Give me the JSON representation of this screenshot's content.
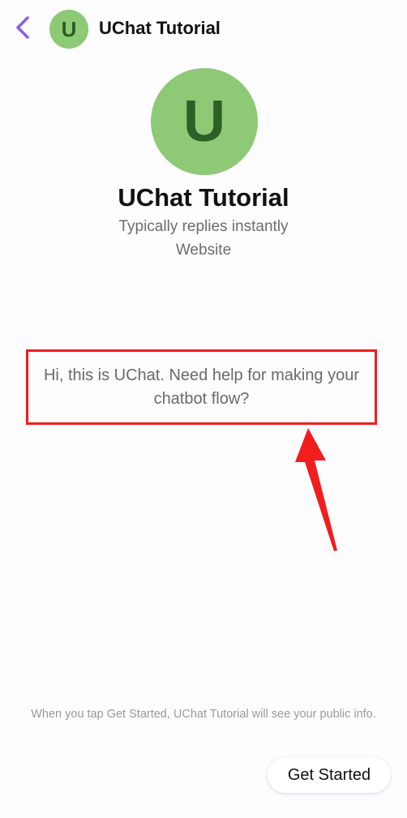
{
  "header": {
    "back_icon": "chevron-left-icon",
    "avatar_letter": "U",
    "title": "UChat Tutorial"
  },
  "profile": {
    "avatar_letter": "U",
    "name": "UChat Tutorial",
    "reply_time": "Typically replies instantly",
    "channel": "Website"
  },
  "greeting": {
    "message": "Hi, this is UChat. Need help for making your chatbot flow?"
  },
  "footer": {
    "consent_text": "When you tap Get Started, UChat Tutorial will see your public info.",
    "get_started_label": "Get Started"
  },
  "colors": {
    "accent": "#8b5cf6",
    "avatar_bg": "#8ec976",
    "highlight": "#f21d1d"
  }
}
